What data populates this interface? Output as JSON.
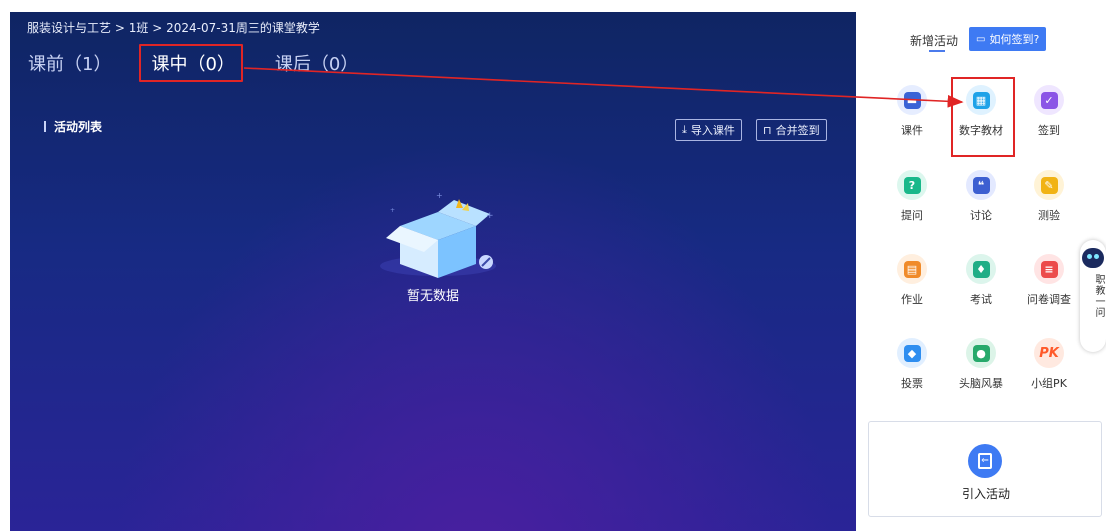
{
  "breadcrumb": {
    "course": "服装设计与工艺",
    "sep1": ">",
    "class": "1班",
    "sep2": ">",
    "session": "2024-07-31周三的课堂教学"
  },
  "tabs": [
    {
      "label": "课前（1）",
      "active": false
    },
    {
      "label": "课中（0）",
      "active": true
    },
    {
      "label": "课后（0）",
      "active": false
    }
  ],
  "section_title": "活动列表",
  "toolbar": {
    "import_icon": "download-icon",
    "import_label": "导入课件",
    "merge_icon": "merge-icon",
    "merge_label": "合并签到"
  },
  "empty_state": {
    "icon": "empty-box-icon",
    "text": "暂无数据"
  },
  "sidebar": {
    "header_label": "新增活动",
    "help_button_label": "如何签到?",
    "activities": [
      {
        "label": "课件",
        "icon": "courseware-icon",
        "color": "#3a63d6",
        "bg": "#e6edff",
        "glyph": "▬"
      },
      {
        "label": "数字教材",
        "icon": "digital-textbook-icon",
        "color": "#1fa2e8",
        "bg": "#dff2ff",
        "glyph": "▦"
      },
      {
        "label": "签到",
        "icon": "checkin-icon",
        "color": "#8b55e6",
        "bg": "#efe6ff",
        "glyph": "✓"
      },
      {
        "label": "提问",
        "icon": "question-icon",
        "color": "#19b88a",
        "bg": "#dcf7ee",
        "glyph": "?"
      },
      {
        "label": "讨论",
        "icon": "discussion-icon",
        "color": "#3d5fd1",
        "bg": "#e3e9ff",
        "glyph": "❝"
      },
      {
        "label": "测验",
        "icon": "quiz-icon",
        "color": "#f1b315",
        "bg": "#fff3d6",
        "glyph": "✎"
      },
      {
        "label": "作业",
        "icon": "homework-icon",
        "color": "#f08b2a",
        "bg": "#ffefdf",
        "glyph": "▤"
      },
      {
        "label": "考试",
        "icon": "exam-icon",
        "color": "#1fae86",
        "bg": "#dcf5ec",
        "glyph": "♦"
      },
      {
        "label": "问卷调查",
        "icon": "survey-icon",
        "color": "#ec4b4b",
        "bg": "#ffe4e4",
        "glyph": "≡"
      },
      {
        "label": "投票",
        "icon": "vote-icon",
        "color": "#2f8ef0",
        "bg": "#e1efff",
        "glyph": "◆"
      },
      {
        "label": "头脑风暴",
        "icon": "brainstorm-icon",
        "color": "#27a96b",
        "bg": "#dcf4e8",
        "glyph": "●"
      },
      {
        "label": "小组PK",
        "icon": "group-pk-icon",
        "color": "#ff5a2a",
        "bg": "#ffe9e0",
        "glyph": "PK"
      }
    ],
    "import_activity_label": "引入活动",
    "import_activity_icon": "import-activity-icon"
  },
  "assistant": {
    "icon": "robot-icon",
    "label": "职教一问"
  }
}
